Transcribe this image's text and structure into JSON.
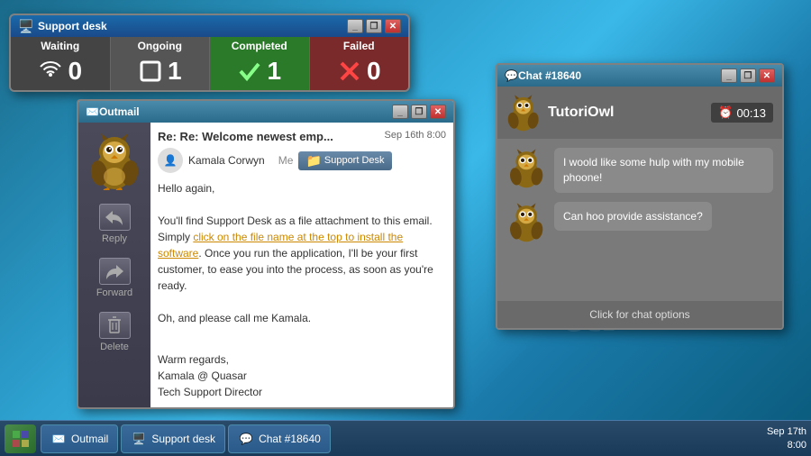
{
  "desktop": {
    "text": "ar"
  },
  "support_desk_window": {
    "title": "Support desk",
    "stats": {
      "waiting": {
        "label": "Waiting",
        "value": "0"
      },
      "ongoing": {
        "label": "Ongoing",
        "value": "1"
      },
      "completed": {
        "label": "Completed",
        "value": "1"
      },
      "failed": {
        "label": "Failed",
        "value": "0"
      }
    },
    "controls": {
      "minimize": "_",
      "restore": "❐",
      "close": "✕"
    }
  },
  "outmail_window": {
    "title": "Outmail",
    "subject": "Re: Re: Welcome newest emp...",
    "date": "Sep 16th 8:00",
    "from": "Kamala Corwyn",
    "cc": "Me",
    "label": "Support Desk",
    "body_greeting": "Hello again,",
    "body_p1": "You'll find Support Desk as a file attachment to this email. Simply ",
    "body_link": "click on the file name at the top to install the software",
    "body_p2": ". Once you run the application, I'll be your first customer, to ease you into the process, as soon as you're ready.",
    "body_p3": "Oh, and please call me Kamala.",
    "body_closing": "Warm regards,",
    "body_sig1": "Kamala @ Quasar",
    "body_sig2": "Tech Support Director",
    "actions": {
      "reply": "Reply",
      "forward": "Forward",
      "delete": "Delete"
    }
  },
  "chat_window": {
    "title": "Chat #18640",
    "agent_name": "TutoriOwl",
    "timer": "00:13",
    "messages": [
      {
        "text": "I woold like some hulp with my mobile phoone!"
      },
      {
        "text": "Can hoo provide assistance?"
      }
    ],
    "footer": "Click for chat options",
    "controls": {
      "minimize": "_",
      "restore": "❐",
      "close": "✕"
    }
  },
  "taskbar": {
    "items": [
      {
        "label": "Outmail"
      },
      {
        "label": "Support desk"
      },
      {
        "label": "Chat #18640"
      }
    ],
    "clock_date": "Sep 17th",
    "clock_time": "8:00"
  }
}
